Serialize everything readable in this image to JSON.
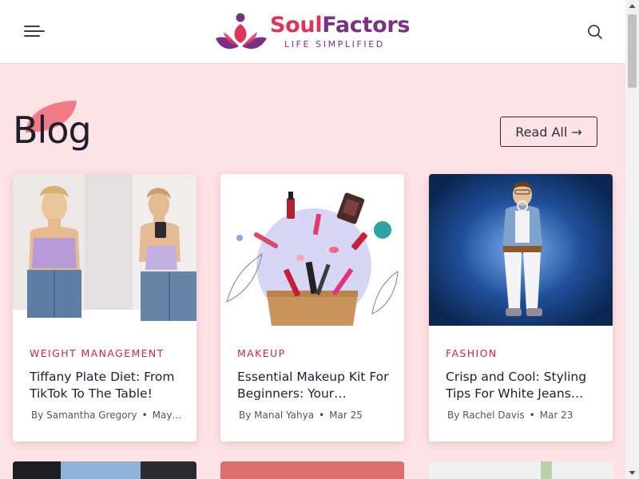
{
  "brand": {
    "name_part1": "Soul",
    "name_part2": "Factors",
    "tagline": "LIFE SIMPLIFIED",
    "colors": {
      "pink": "#e0335c",
      "purple": "#7b2f86"
    }
  },
  "header": {
    "menu_icon": "hamburger-menu-icon",
    "search_icon": "search-icon"
  },
  "section": {
    "title": "Blog",
    "read_all_label": "Read All →"
  },
  "posts": [
    {
      "category": "WEIGHT MANAGEMENT",
      "title": "Tiffany Plate Diet: From TikTok To The Table!",
      "author": "By Samantha Gregory",
      "date": "May…"
    },
    {
      "category": "MAKEUP",
      "title": "Essential Makeup Kit For Beginners: Your…",
      "author": "By Manal Yahya",
      "date": "Mar 25"
    },
    {
      "category": "FASHION",
      "title": "Crisp and Cool: Styling Tips For White Jeans…",
      "author": "By Rachel Davis",
      "date": "Mar 23"
    }
  ],
  "colors": {
    "page_bg": "#fde2e6",
    "category_red": "#d3234a",
    "text_dark": "#1f1f2b"
  }
}
